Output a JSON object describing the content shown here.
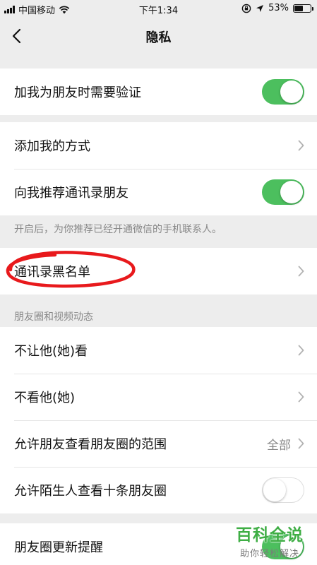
{
  "status_bar": {
    "carrier": "中国移动",
    "time": "下午1:34",
    "battery_text": "53%",
    "battery_level_percent": 53,
    "icons": [
      "signal-icon",
      "wifi-icon",
      "orientation-lock-icon",
      "location-icon",
      "battery-icon"
    ]
  },
  "nav": {
    "title": "隐私",
    "back_icon": "chevron-left-icon"
  },
  "sections": {
    "verify": {
      "label": "加我为朋友时需要验证",
      "toggle_on": true
    },
    "add_me": {
      "ways_label": "添加我的方式",
      "recommend_label": "向我推荐通讯录朋友",
      "recommend_toggle_on": true,
      "note": "开启后，为你推荐已经开通微信的手机联系人。"
    },
    "blacklist": {
      "label": "通讯录黑名单"
    },
    "moments": {
      "header": "朋友圈和视频动态",
      "hide_from_label": "不让他(她)看",
      "not_see_label": "不看他(她)",
      "range_label": "允许朋友查看朋友圈的范围",
      "range_value": "全部",
      "stranger_label": "允许陌生人查看十条朋友圈",
      "stranger_toggle_on": false
    },
    "moments_update": {
      "label": "朋友圈更新提醒",
      "toggle_on": true
    }
  },
  "watermark": {
    "main": "百科全说",
    "sub": "助你轻松解决"
  },
  "colors": {
    "toggle_on": "#4cbf5e",
    "annotation_red": "#e8191c",
    "watermark_green": "#3fae45",
    "background": "#ededed"
  }
}
